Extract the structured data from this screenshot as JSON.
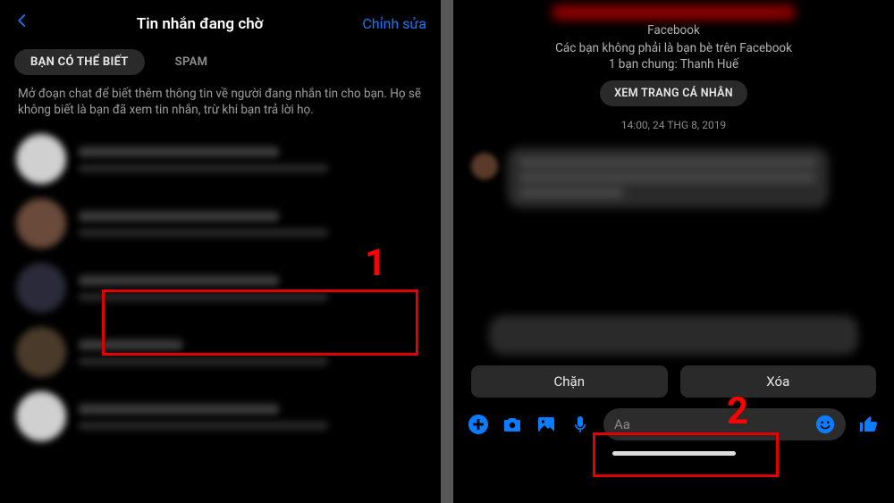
{
  "left": {
    "title": "Tin nhắn đang chờ",
    "edit": "Chỉnh sửa",
    "tabs": {
      "known": "BẠN CÓ THỂ BIẾT",
      "spam": "SPAM"
    },
    "hint": "Mở đoạn chat để biết thêm thông tin về người đang nhắn tin cho bạn. Họ sẽ không biết là bạn đã xem tin nhắn, trừ khi bạn trả lời họ.",
    "annotation": "1"
  },
  "right": {
    "platform": "Facebook",
    "not_friends": "Các bạn không phải là bạn bè trên Facebook",
    "mutual": "1 bạn chung: Thanh Huế",
    "view_profile": "XEM TRANG CÁ NHÂN",
    "timestamp": "14:00, 24 THG 8, 2019",
    "actions": {
      "block": "Chặn",
      "delete": "Xóa"
    },
    "composer": {
      "placeholder": "Aa"
    },
    "annotation": "2"
  }
}
